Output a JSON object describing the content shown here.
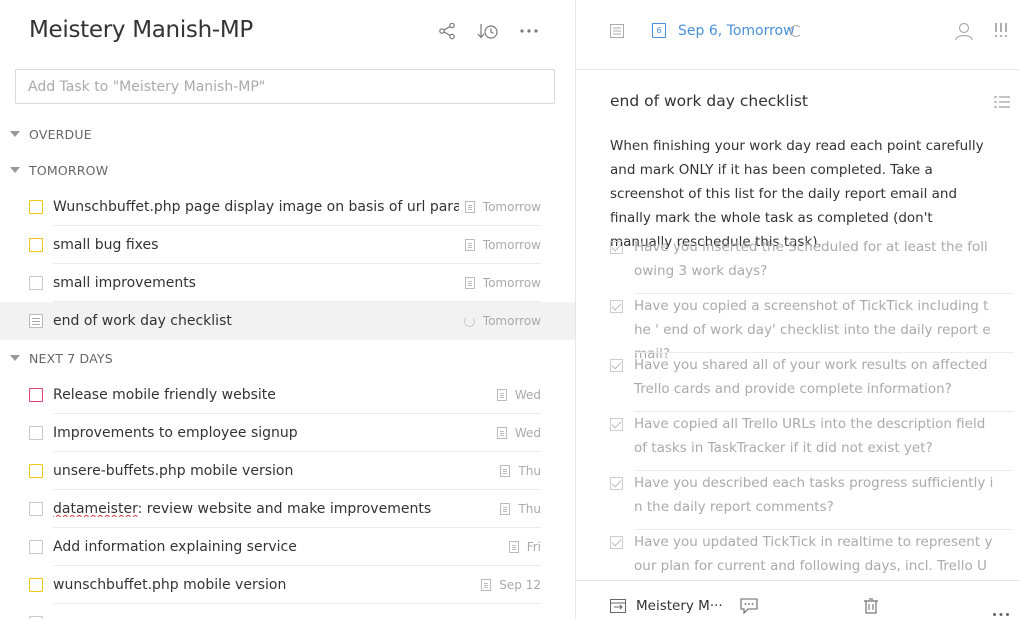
{
  "list": {
    "title": "Meistery Manish-MP",
    "add_placeholder": "Add Task to \"Meistery Manish-MP\"",
    "header_icons": [
      "share-icon",
      "sort-icon",
      "more-icon"
    ]
  },
  "sections": {
    "overdue": "OVERDUE",
    "tomorrow": "TOMORROW",
    "next7": "NEXT 7 DAYS"
  },
  "tasks": [
    {
      "title": "Wunschbuffet.php page display image on basis of url parameters",
      "date": "Tomorrow",
      "priority": "yellow",
      "icon": "note-icon"
    },
    {
      "title": "small bug fixes",
      "date": "Tomorrow",
      "priority": "yellow",
      "icon": "note-icon"
    },
    {
      "title": "small improvements",
      "date": "Tomorrow",
      "priority": "none",
      "icon": "note-icon"
    },
    {
      "title": "end of work day checklist",
      "date": "Tomorrow",
      "priority": "checklist",
      "icon": "repeat-icon",
      "selected": true
    },
    {
      "title": "Release mobile friendly website",
      "date": "Wed",
      "priority": "pink",
      "icon": "note-icon"
    },
    {
      "title": "Improvements to employee signup",
      "date": "Wed",
      "priority": "none",
      "icon": "note-icon"
    },
    {
      "title": "unsere-buffets.php mobile version",
      "date": "Thu",
      "priority": "yellow",
      "icon": "note-icon"
    },
    {
      "title_spell": "datameister",
      "title_rest": ": review website and make improvements",
      "date": "Thu",
      "priority": "none",
      "icon": "note-icon"
    },
    {
      "title": "Add information explaining service",
      "date": "Fri",
      "priority": "none",
      "icon": "note-icon"
    },
    {
      "title": "wunschbuffet.php mobile version",
      "date": "Sep 12",
      "priority": "yellow",
      "icon": "note-icon"
    }
  ],
  "detail": {
    "date": "Sep 6, Tomorrow",
    "calendar_day": "6",
    "title": "end of work day checklist",
    "description": "When finishing your work day read each point carefully and mark ONLY if it has been completed. Take a screenshot of this list for the daily report email and finally mark the whole task as completed (don't manually reschedule this task).",
    "checklist": [
      "Have you inserted the Scheduled for at least the following 3 work days?",
      "Have you copied a screenshot of TickTick including the ' end of work day' checklist into the daily report email?",
      "Have you shared all of your work results on affected Trello cards and provide complete information?",
      "Have copied all Trello URLs into the description field of tasks in TaskTracker if it did not exist yet?",
      "Have you described each tasks progress sufficiently in the daily report comments?",
      "Have you updated TickTick in realtime to represent your plan for current and following days, incl. Trello URLs?"
    ],
    "list_name": "Meistery M···"
  }
}
